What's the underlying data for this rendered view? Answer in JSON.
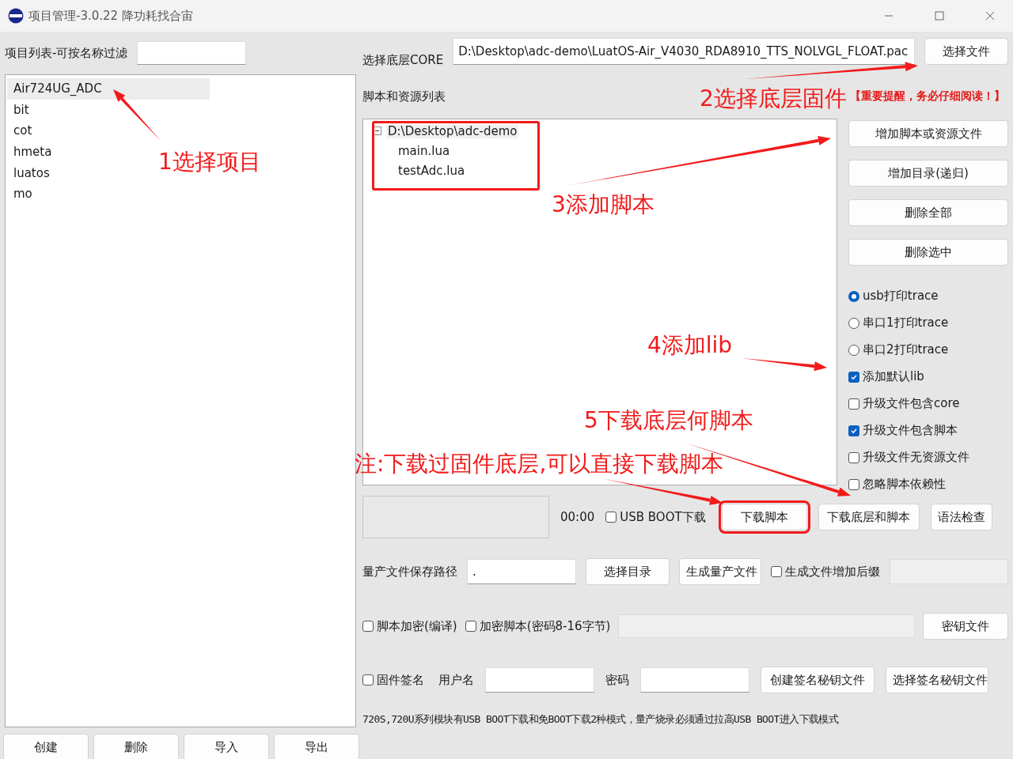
{
  "window": {
    "title": "项目管理-3.0.22 降功耗找合宙"
  },
  "project_filter": {
    "label": "项目列表-可按名称过滤"
  },
  "projects": [
    {
      "label": "Air724UG_ADC",
      "selected": true
    },
    {
      "label": "bit",
      "selected": false
    },
    {
      "label": "cot",
      "selected": false
    },
    {
      "label": "hmeta",
      "selected": false
    },
    {
      "label": "luatos",
      "selected": false
    },
    {
      "label": "mo",
      "selected": false
    }
  ],
  "project_buttons": [
    "创建",
    "删除",
    "导入",
    "导出"
  ],
  "core": {
    "label": "选择底层CORE",
    "path": "D:\\Desktop\\adc-demo\\LuatOS-Air_V4030_RDA8910_TTS_NOLVGL_FLOAT.pac",
    "button": "选择文件"
  },
  "scripts": {
    "label": "脚本和资源列表",
    "notice": "【重要提醒，务必仔细阅读！】",
    "tree": [
      {
        "label": "D:\\Desktop\\adc-demo",
        "expanded": true,
        "children": [
          {
            "label": "main.lua"
          },
          {
            "label": "testAdc.lua"
          }
        ]
      }
    ]
  },
  "script_buttons": [
    "增加脚本或资源文件",
    "增加目录(递归)",
    "删除全部",
    "删除选中"
  ],
  "options": [
    {
      "kind": "radio",
      "label": "usb打印trace",
      "checked": true
    },
    {
      "kind": "radio",
      "label": "串口1打印trace",
      "checked": false
    },
    {
      "kind": "radio",
      "label": "串口2打印trace",
      "checked": false
    },
    {
      "kind": "checkbox",
      "label": "添加默认lib",
      "checked": true
    },
    {
      "kind": "checkbox",
      "label": "升级文件包含core",
      "checked": false
    },
    {
      "kind": "checkbox",
      "label": "升级文件包含脚本",
      "checked": true
    },
    {
      "kind": "checkbox",
      "label": "升级文件无资源文件",
      "checked": false
    },
    {
      "kind": "checkbox",
      "label": "忽略脚本依赖性",
      "checked": false
    }
  ],
  "download": {
    "time": "00:00",
    "usb_boot": {
      "label": "USB BOOT下载",
      "checked": false
    },
    "buttons": [
      "下载脚本",
      "下载底层和脚本",
      "语法检查"
    ]
  },
  "production": {
    "label": "量产文件保存路径",
    "path": ".",
    "buttons": [
      "选择目录",
      "生成量产文件"
    ],
    "suffix": {
      "label": "生成文件增加后缀",
      "checked": false
    }
  },
  "encryption": {
    "compile": {
      "label": "脚本加密(编译)",
      "checked": false
    },
    "password": {
      "label": "加密脚本(密码8-16字节)",
      "checked": false
    },
    "button": "密钥文件"
  },
  "signing": {
    "sign": {
      "label": "固件签名",
      "checked": false
    },
    "user_label": "用户名",
    "password_label": "密码",
    "buttons": [
      "创建签名秘钥文件",
      "选择签名秘钥文件"
    ]
  },
  "note": "720S,720U系列模块有USB BOOT下载和免BOOT下载2种模式，量产烧录必须通过拉高USB BOOT进入下载模式",
  "annotations": [
    {
      "text": "1选择项目"
    },
    {
      "text": "2选择底层固件"
    },
    {
      "text": "3添加脚本"
    },
    {
      "text": "4添加lib"
    },
    {
      "text": "5下载底层何脚本"
    },
    {
      "text": "注:下载过固件底层,可以直接下载脚本"
    }
  ]
}
